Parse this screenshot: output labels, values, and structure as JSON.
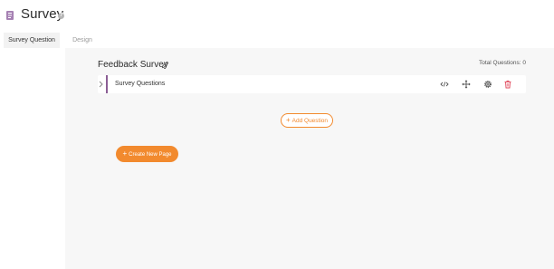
{
  "header": {
    "title": "Survey",
    "icon": "survey-icon",
    "help_icon": "help-icon",
    "help_glyph": "?"
  },
  "tabs": [
    {
      "label": "Survey Question",
      "active": true
    },
    {
      "label": "Design",
      "active": false
    }
  ],
  "survey": {
    "title": "Feedback Survey",
    "total_questions_label": "Total Questions: 0"
  },
  "pages": [
    {
      "label": "Survey Questions",
      "accent_color": "#8b5e95"
    }
  ],
  "row_actions": [
    "code-icon",
    "move-icon",
    "settings-icon",
    "trash-icon"
  ],
  "buttons": {
    "add_question": "Add Question",
    "create_page": "Create New Page",
    "plus_glyph": "+"
  },
  "colors": {
    "accent": "#f28a2e",
    "delete": "#e0475a",
    "icon_purple": "#a681b3"
  }
}
